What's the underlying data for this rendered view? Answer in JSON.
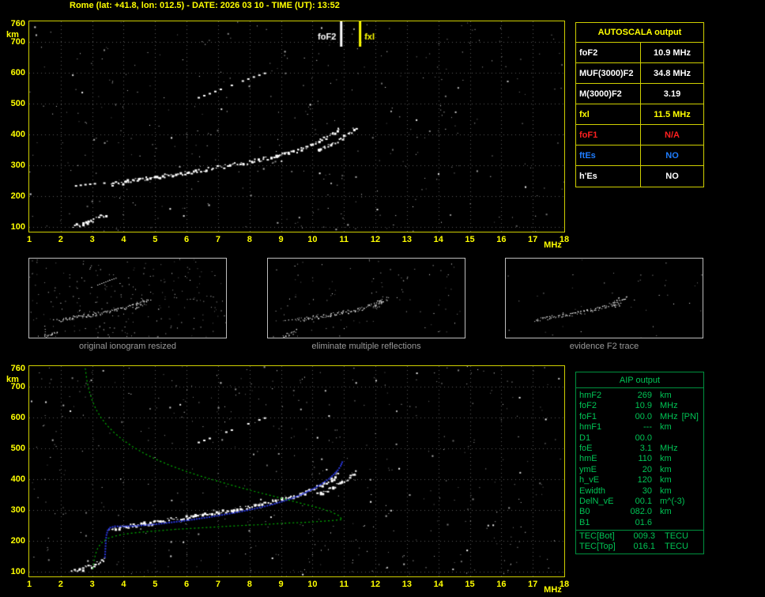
{
  "title": "Rome (lat: +41.8, lon: 012.5) - DATE: 2026 03 10 - TIME (UT): 13:52",
  "colors": {
    "background": "#000000",
    "axis": "#ffff00",
    "grid": "#5a5a5a",
    "trace": "#ffffff",
    "fitted_trace": "#2937e0",
    "profile": "#00b400",
    "aip_text": "#00c455",
    "caption": "#9a9a9a"
  },
  "autoscala_table": {
    "title": "AUTOSCALA output",
    "rows": [
      {
        "param": "foF2",
        "value": "10.9 MHz",
        "color": "#ffffff"
      },
      {
        "param": "MUF(3000)F2",
        "value": "34.8 MHz",
        "color": "#ffffff"
      },
      {
        "param": "M(3000)F2",
        "value": "3.19",
        "color": "#ffffff"
      },
      {
        "param": "fxl",
        "value": "11.5 MHz",
        "color": "#ffff00"
      },
      {
        "param": "foF1",
        "value": "N/A",
        "color": "#ff2020"
      },
      {
        "param": "ftEs",
        "value": "NO",
        "color": "#1f7dff"
      },
      {
        "param": "h'Es",
        "value": "NO",
        "color": "#ffffff"
      }
    ]
  },
  "thumbnails": [
    {
      "caption": "original ionogram resized",
      "noise": 230,
      "layers": [
        "F2-trace-O",
        "F2-trace-X",
        "E-region-echoes",
        "low-freq-dashes",
        "second-hop-trace"
      ]
    },
    {
      "caption": "eliminate multiple reflections",
      "noise": 100,
      "layers": [
        "F2-trace-O",
        "F2-trace-X",
        "E-region-echoes",
        "low-freq-dashes"
      ]
    },
    {
      "caption": "evidence F2 trace",
      "noise": 40,
      "layers": [
        "F2-trace-O",
        "F2-trace-X"
      ]
    }
  ],
  "aip_table": {
    "title": "AIP output",
    "rows": [
      {
        "param": "hmF2",
        "value": "269",
        "unit": "km",
        "extra": ""
      },
      {
        "param": "foF2",
        "value": "10.9",
        "unit": "MHz",
        "extra": ""
      },
      {
        "param": "foF1",
        "value": "00.0",
        "unit": "MHz",
        "extra": "[PN]"
      },
      {
        "param": "hmF1",
        "value": "---",
        "unit": "km",
        "extra": ""
      },
      {
        "param": "D1",
        "value": "00.0",
        "unit": "",
        "extra": ""
      },
      {
        "param": "foE",
        "value": "3.1",
        "unit": "MHz",
        "extra": ""
      },
      {
        "param": "hmE",
        "value": "110",
        "unit": "km",
        "extra": ""
      },
      {
        "param": "ymE",
        "value": "20",
        "unit": "km",
        "extra": ""
      },
      {
        "param": "h_vE",
        "value": "120",
        "unit": "km",
        "extra": ""
      },
      {
        "param": "Ewidth",
        "value": "30",
        "unit": "km",
        "extra": ""
      },
      {
        "param": "DelN_vE",
        "value": "00.1",
        "unit": "m^(-3)",
        "extra": ""
      },
      {
        "param": "B0",
        "value": "082.0",
        "unit": "km",
        "extra": ""
      },
      {
        "param": "B1",
        "value": "01.6",
        "unit": "",
        "extra": ""
      }
    ],
    "tec_rows": [
      {
        "param": "TEC[Bot]",
        "value": "009.3",
        "unit": "TECU"
      },
      {
        "param": "TEC[Top]",
        "value": "016.1",
        "unit": "TECU"
      }
    ]
  },
  "chart_data": [
    {
      "id": "top",
      "type": "scatter",
      "title": "measured ionogram",
      "xlabel": "MHz",
      "ylabel": "km",
      "xlim": [
        1,
        18
      ],
      "ylim": [
        85,
        767
      ],
      "xticks": [
        1,
        2,
        3,
        4,
        5,
        6,
        7,
        8,
        9,
        10,
        11,
        12,
        13,
        14,
        15,
        16,
        17,
        18
      ],
      "yticks": [
        100,
        200,
        300,
        400,
        500,
        600,
        700,
        760
      ],
      "grid": true,
      "noise_dots": 340,
      "noise_seed": 7,
      "markers": [
        {
          "label": "foF2",
          "x": 10.9,
          "color": "#ffffff",
          "label_side": "left"
        },
        {
          "label": "fxl",
          "x": 11.5,
          "color": "#ffff00",
          "label_side": "right"
        }
      ],
      "series": [
        {
          "name": "F2-trace-O",
          "color": "#ffffff",
          "style": "blocky",
          "points": [
            [
              3.55,
              240
            ],
            [
              3.8,
              245
            ],
            [
              4.1,
              250
            ],
            [
              4.4,
              255
            ],
            [
              4.8,
              261
            ],
            [
              5.2,
              267
            ],
            [
              5.6,
              273
            ],
            [
              6.0,
              279
            ],
            [
              6.4,
              285
            ],
            [
              6.8,
              292
            ],
            [
              7.2,
              299
            ],
            [
              7.6,
              306
            ],
            [
              8.0,
              314
            ],
            [
              8.4,
              322
            ],
            [
              8.8,
              331
            ],
            [
              9.1,
              339
            ],
            [
              9.4,
              348
            ],
            [
              9.7,
              358
            ],
            [
              9.95,
              368
            ],
            [
              10.2,
              379
            ],
            [
              10.4,
              390
            ],
            [
              10.55,
              400
            ],
            [
              10.7,
              411
            ],
            [
              10.8,
              421
            ]
          ]
        },
        {
          "name": "F2-trace-X",
          "color": "#ffffff",
          "style": "blocky",
          "points": [
            [
              10.15,
              352
            ],
            [
              10.35,
              360
            ],
            [
              10.55,
              370
            ],
            [
              10.75,
              381
            ],
            [
              10.95,
              393
            ],
            [
              11.1,
              404
            ],
            [
              11.25,
              416
            ],
            [
              11.35,
              427
            ]
          ]
        },
        {
          "name": "E-region-echoes",
          "color": "#ffffff",
          "style": "blocky",
          "points": [
            [
              2.35,
              104
            ],
            [
              2.55,
              109
            ],
            [
              2.75,
              114
            ],
            [
              2.95,
              121
            ],
            [
              3.1,
              128
            ],
            [
              3.25,
              136
            ],
            [
              3.38,
              144
            ]
          ]
        },
        {
          "name": "low-freq-dashes",
          "color": "#ffffff",
          "style": "sparse",
          "points": [
            [
              2.45,
              236
            ],
            [
              2.75,
              240
            ],
            [
              3.05,
              243
            ],
            [
              3.35,
              245
            ]
          ]
        },
        {
          "name": "second-hop-trace",
          "color": "#ffffff",
          "style": "sparse",
          "points": [
            [
              6.35,
              522
            ],
            [
              6.7,
              535
            ],
            [
              7.05,
              549
            ],
            [
              7.4,
              562
            ],
            [
              7.75,
              576
            ],
            [
              8.1,
              589
            ],
            [
              8.45,
              601
            ]
          ]
        }
      ]
    },
    {
      "id": "bottom",
      "type": "scatter",
      "title": "autoscaled ionogram with restored profile",
      "xlabel": "MHz",
      "ylabel": "km",
      "xlim": [
        1,
        18
      ],
      "ylim": [
        85,
        767
      ],
      "xticks": [
        1,
        2,
        3,
        4,
        5,
        6,
        7,
        8,
        9,
        10,
        11,
        12,
        13,
        14,
        15,
        16,
        17,
        18
      ],
      "yticks": [
        100,
        200,
        300,
        400,
        500,
        600,
        700,
        760
      ],
      "grid": true,
      "noise_dots": 430,
      "noise_seed": 13,
      "markers": [],
      "series": [
        {
          "name": "F2-trace-O",
          "color": "#ffffff",
          "style": "blocky",
          "points": [
            [
              3.55,
              240
            ],
            [
              3.8,
              245
            ],
            [
              4.1,
              250
            ],
            [
              4.4,
              255
            ],
            [
              4.8,
              261
            ],
            [
              5.2,
              267
            ],
            [
              5.6,
              273
            ],
            [
              6.0,
              279
            ],
            [
              6.4,
              285
            ],
            [
              6.8,
              292
            ],
            [
              7.2,
              299
            ],
            [
              7.6,
              306
            ],
            [
              8.0,
              314
            ],
            [
              8.4,
              322
            ],
            [
              8.8,
              331
            ],
            [
              9.1,
              339
            ],
            [
              9.4,
              348
            ],
            [
              9.7,
              358
            ],
            [
              9.95,
              368
            ],
            [
              10.2,
              379
            ],
            [
              10.4,
              390
            ],
            [
              10.55,
              400
            ],
            [
              10.7,
              411
            ],
            [
              10.8,
              421
            ]
          ]
        },
        {
          "name": "F2-trace-X",
          "color": "#ffffff",
          "style": "blocky",
          "points": [
            [
              10.15,
              352
            ],
            [
              10.35,
              360
            ],
            [
              10.55,
              370
            ],
            [
              10.75,
              381
            ],
            [
              10.95,
              393
            ],
            [
              11.1,
              404
            ],
            [
              11.25,
              416
            ],
            [
              11.35,
              427
            ]
          ]
        },
        {
          "name": "E-region-echoes",
          "color": "#ffffff",
          "style": "blocky",
          "points": [
            [
              2.35,
              104
            ],
            [
              2.55,
              109
            ],
            [
              2.75,
              114
            ],
            [
              2.95,
              121
            ],
            [
              3.1,
              128
            ],
            [
              3.25,
              136
            ],
            [
              3.38,
              144
            ]
          ]
        },
        {
          "name": "second-hop-trace",
          "color": "#ffffff",
          "style": "sparse",
          "points": [
            [
              6.35,
              522
            ],
            [
              6.7,
              535
            ],
            [
              7.05,
              549
            ],
            [
              7.4,
              562
            ],
            [
              7.75,
              576
            ],
            [
              8.1,
              589
            ],
            [
              8.45,
              601
            ]
          ]
        },
        {
          "name": "fitted-trace",
          "color": "#2937e0",
          "style": "dots",
          "points": [
            [
              3.38,
              150
            ],
            [
              3.39,
              168
            ],
            [
              3.4,
              186
            ],
            [
              3.41,
              204
            ],
            [
              3.43,
              222
            ],
            [
              3.47,
              237
            ],
            [
              3.55,
              246
            ],
            [
              3.7,
              250
            ],
            [
              3.95,
              250
            ],
            [
              4.3,
              251
            ],
            [
              4.7,
              254
            ],
            [
              5.1,
              258
            ],
            [
              5.5,
              263
            ],
            [
              5.9,
              268
            ],
            [
              6.3,
              274
            ],
            [
              6.7,
              280
            ],
            [
              7.1,
              287
            ],
            [
              7.5,
              294
            ],
            [
              7.9,
              302
            ],
            [
              8.3,
              311
            ],
            [
              8.7,
              321
            ],
            [
              9.0,
              330
            ],
            [
              9.3,
              340
            ],
            [
              9.6,
              352
            ],
            [
              9.85,
              364
            ],
            [
              10.1,
              377
            ],
            [
              10.3,
              390
            ],
            [
              10.5,
              404
            ],
            [
              10.65,
              418
            ],
            [
              10.78,
              432
            ],
            [
              10.87,
              446
            ],
            [
              10.92,
              458
            ]
          ]
        },
        {
          "name": "profile-topside",
          "color": "#00b400",
          "style": "dashline",
          "points": [
            [
              2.78,
              760
            ],
            [
              2.83,
              722
            ],
            [
              2.9,
              688
            ],
            [
              3.0,
              656
            ],
            [
              3.12,
              627
            ],
            [
              3.28,
              600
            ],
            [
              3.47,
              575
            ],
            [
              3.7,
              551
            ],
            [
              3.97,
              528
            ],
            [
              4.28,
              506
            ],
            [
              4.63,
              485
            ],
            [
              5.02,
              465
            ],
            [
              5.45,
              446
            ],
            [
              5.92,
              428
            ],
            [
              6.42,
              411
            ],
            [
              6.95,
              395
            ],
            [
              7.5,
              379
            ],
            [
              8.07,
              363
            ],
            [
              8.65,
              348
            ],
            [
              9.22,
              333
            ],
            [
              9.76,
              319
            ],
            [
              10.24,
              306
            ],
            [
              10.6,
              294
            ],
            [
              10.82,
              283
            ],
            [
              10.92,
              272
            ]
          ]
        },
        {
          "name": "profile-bottomside",
          "color": "#00b400",
          "style": "dashline",
          "points": [
            [
              10.92,
              269
            ],
            [
              10.6,
              266
            ],
            [
              10.2,
              263
            ],
            [
              9.7,
              260
            ],
            [
              9.2,
              258
            ],
            [
              8.7,
              255
            ],
            [
              8.2,
              252
            ],
            [
              7.7,
              250
            ],
            [
              7.2,
              247
            ],
            [
              6.7,
              244
            ],
            [
              6.2,
              241
            ],
            [
              5.7,
              238
            ],
            [
              5.2,
              234
            ],
            [
              4.7,
              230
            ],
            [
              4.3,
              226
            ],
            [
              3.95,
              221
            ],
            [
              3.7,
              215
            ],
            [
              3.5,
              208
            ],
            [
              3.35,
              199
            ],
            [
              3.25,
              188
            ],
            [
              3.17,
              175
            ],
            [
              3.12,
              161
            ],
            [
              3.08,
              146
            ],
            [
              3.05,
              131
            ],
            [
              3.03,
              116
            ],
            [
              3.02,
              102
            ]
          ]
        }
      ]
    }
  ]
}
